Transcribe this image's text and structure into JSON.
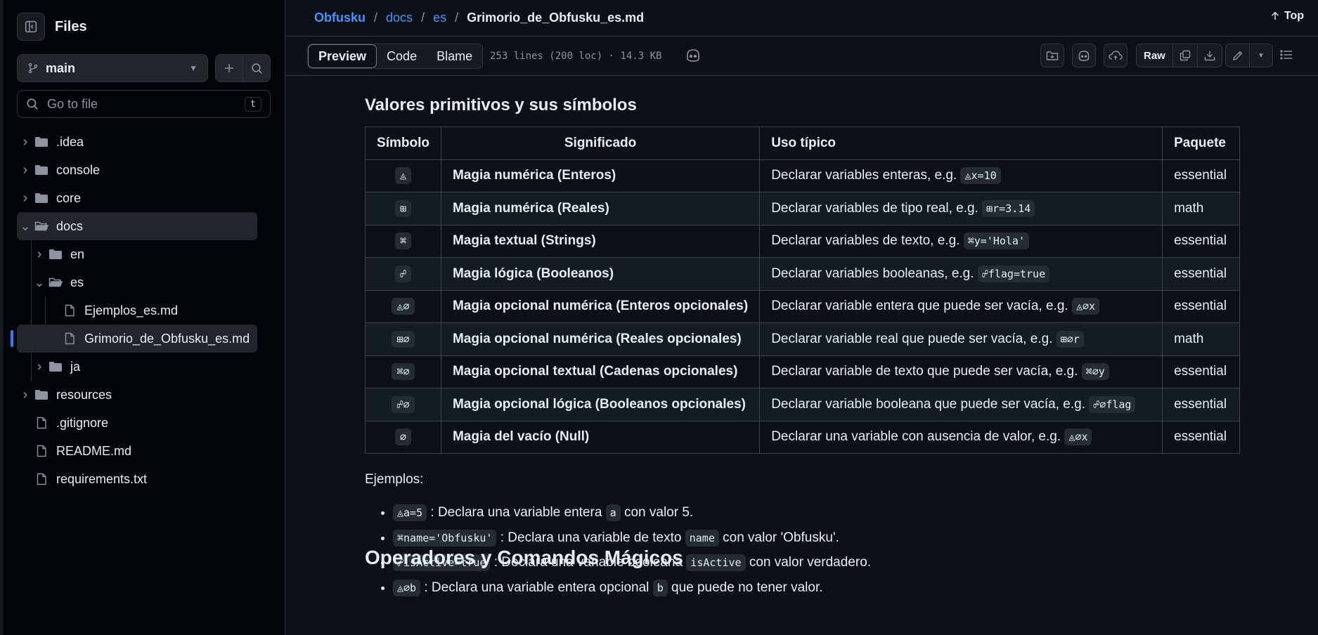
{
  "sidebar": {
    "title": "Files",
    "branch": "main",
    "goto_placeholder": "Go to file",
    "goto_shortcut": "t",
    "tree": [
      {
        "label": ".idea",
        "type": "folder",
        "depth": 0,
        "state": "collapsed"
      },
      {
        "label": "console",
        "type": "folder",
        "depth": 0,
        "state": "collapsed"
      },
      {
        "label": "core",
        "type": "folder",
        "depth": 0,
        "state": "collapsed"
      },
      {
        "label": "docs",
        "type": "folder",
        "depth": 0,
        "state": "expanded"
      },
      {
        "label": "en",
        "type": "folder",
        "depth": 1,
        "state": "collapsed"
      },
      {
        "label": "es",
        "type": "folder",
        "depth": 1,
        "state": "expanded"
      },
      {
        "label": "Ejemplos_es.md",
        "type": "file",
        "depth": 2
      },
      {
        "label": "Grimorio_de_Obfusku_es.md",
        "type": "file",
        "depth": 2,
        "selected": true
      },
      {
        "label": "ja",
        "type": "folder",
        "depth": 1,
        "state": "collapsed"
      },
      {
        "label": "resources",
        "type": "folder",
        "depth": 0,
        "state": "collapsed"
      },
      {
        "label": ".gitignore",
        "type": "file",
        "depth": 0
      },
      {
        "label": "README.md",
        "type": "file",
        "depth": 0
      },
      {
        "label": "requirements.txt",
        "type": "file",
        "depth": 0
      }
    ]
  },
  "breadcrumb": {
    "repo": "Obfusku",
    "dir1": "docs",
    "dir2": "es",
    "file": "Grimorio_de_Obfusku_es.md"
  },
  "top_link": "Top",
  "toolbar": {
    "tabs": [
      "Preview",
      "Code",
      "Blame"
    ],
    "active_tab": "Preview",
    "meta": "253 lines (200 loc) · 14.3 KB",
    "raw_label": "Raw"
  },
  "content": {
    "section_title": "Valores primitivos y sus símbolos",
    "table": {
      "headers": [
        "Símbolo",
        "Significado",
        "Uso típico",
        "Paquete"
      ],
      "rows": [
        {
          "symbol": "◬",
          "meaning": "Magia numérica (Enteros)",
          "usage": "Declarar variables enteras, e.g.",
          "code": "◬x=10",
          "package": "essential"
        },
        {
          "symbol": "⊞",
          "meaning": "Magia numérica (Reales)",
          "usage": "Declarar variables de tipo real, e.g.",
          "code": "⊞r=3.14",
          "package": "math"
        },
        {
          "symbol": "⌘",
          "meaning": "Magia textual (Strings)",
          "usage": "Declarar variables de texto, e.g.",
          "code": "⌘y='Hola'",
          "package": "essential"
        },
        {
          "symbol": "☍",
          "meaning": "Magia lógica (Booleanos)",
          "usage": "Declarar variables booleanas, e.g.",
          "code": "☍flag=true",
          "package": "essential"
        },
        {
          "symbol": "◬∅",
          "meaning": "Magia opcional numérica (Enteros opcionales)",
          "usage": "Declarar variable entera que puede ser vacía, e.g.",
          "code": "◬∅x",
          "package": "essential"
        },
        {
          "symbol": "⊞∅",
          "meaning": "Magia opcional numérica (Reales opcionales)",
          "usage": "Declarar variable real que puede ser vacía, e.g.",
          "code": "⊞∅r",
          "package": "math"
        },
        {
          "symbol": "⌘∅",
          "meaning": "Magia opcional textual (Cadenas opcionales)",
          "usage": "Declarar variable de texto que puede ser vacía, e.g.",
          "code": "⌘∅y",
          "package": "essential"
        },
        {
          "symbol": "☍∅",
          "meaning": "Magia opcional lógica (Booleanos opcionales)",
          "usage": "Declarar variable booleana que puede ser vacía, e.g.",
          "code": "☍∅flag",
          "package": "essential"
        },
        {
          "symbol": "∅",
          "meaning": "Magia del vacío (Null)",
          "usage": "Declarar una variable con ausencia de valor, e.g.",
          "code": "◬∅x",
          "package": "essential"
        }
      ]
    },
    "examples_label": "Ejemplos:",
    "examples": [
      {
        "code": "◬a=5",
        "t1": " : Declara una variable entera ",
        "c2": "a",
        "t2": " con valor 5."
      },
      {
        "code": "⌘name='Obfusku'",
        "t1": " : Declara una variable de texto ",
        "c2": "name",
        "t2": " con valor 'Obfusku'."
      },
      {
        "code": "☍isActive=true",
        "t1": " : Declara una variable booleana ",
        "c2": "isActive",
        "t2": " con valor verdadero."
      },
      {
        "code": "◬∅b",
        "t1": " : Declara una variable entera opcional ",
        "c2": "b",
        "t2": " que puede no tener valor."
      }
    ],
    "next_heading": "Operadores y Comandos Mágicos"
  },
  "colors": {
    "accent": "#4493f8",
    "bg": "#0d1117",
    "border": "#30363d",
    "selected_bar": "#2f81f7"
  }
}
